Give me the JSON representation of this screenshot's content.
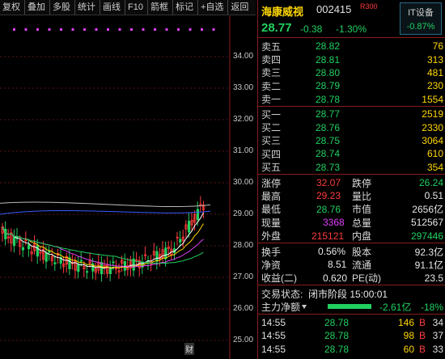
{
  "toolbar": {
    "items": [
      "复权",
      "叠加",
      "多股",
      "统计",
      "画线",
      "F10",
      "箭框",
      "标记",
      "+自选",
      "返回"
    ]
  },
  "chart": {
    "y_ticks": [
      "34.00",
      "33.00",
      "32.00",
      "31.00",
      "30.00",
      "29.00",
      "28.00",
      "27.00",
      "26.00",
      "25.00"
    ],
    "finance_marker": "财"
  },
  "stock": {
    "name": "海康威视",
    "code": "002415",
    "badge": "R300",
    "price": "28.77",
    "change": "-0.38",
    "change_pct": "-1.30%",
    "sector": {
      "name": "IT设备",
      "change": "-0.87%"
    }
  },
  "order_book": {
    "asks": [
      {
        "label": "卖五",
        "price": "28.82",
        "volume": "76"
      },
      {
        "label": "卖四",
        "price": "28.81",
        "volume": "313"
      },
      {
        "label": "卖三",
        "price": "28.80",
        "volume": "481"
      },
      {
        "label": "卖二",
        "price": "28.79",
        "volume": "230"
      },
      {
        "label": "卖一",
        "price": "28.78",
        "volume": "1554"
      }
    ],
    "bids": [
      {
        "label": "买一",
        "price": "28.77",
        "volume": "2519"
      },
      {
        "label": "买二",
        "price": "28.76",
        "volume": "2330"
      },
      {
        "label": "买三",
        "price": "28.75",
        "volume": "3064"
      },
      {
        "label": "买四",
        "price": "28.74",
        "volume": "610"
      },
      {
        "label": "买五",
        "price": "28.73",
        "volume": "354"
      }
    ]
  },
  "stats": {
    "limit_up_label": "涨停",
    "limit_up": "32.07",
    "limit_down_label": "跌停",
    "limit_down": "26.24",
    "high_label": "最高",
    "high": "29.23",
    "vol_ratio_label": "量比",
    "vol_ratio": "0.51",
    "low_label": "最低",
    "low": "28.76",
    "mktcap_label": "市值",
    "mktcap": "2656亿",
    "cur_vol_label": "现量",
    "cur_vol": "3368",
    "total_vol_label": "总量",
    "total_vol": "512567",
    "outer_label": "外盘",
    "outer": "215121",
    "inner_label": "内盘",
    "inner": "297446",
    "turnover_label": "换手",
    "turnover": "0.56%",
    "shares_label": "股本",
    "shares": "92.3亿",
    "nav_label": "净资",
    "nav": "8.51",
    "float_label": "流通",
    "float": "91.1亿",
    "eps_label": "收益(二)",
    "eps": "0.620",
    "pe_label": "PE(动)",
    "pe": "23.5"
  },
  "status": {
    "label": "交易状态:",
    "value": "闭市阶段 15:00:01",
    "flow_label": "主力净额",
    "flow_value": "-2.61亿",
    "flow_pct": "-18%"
  },
  "ticks": [
    {
      "time": "14:55",
      "price": "28.78",
      "volume": "146",
      "side": "B",
      "n": "34"
    },
    {
      "time": "14:55",
      "price": "28.78",
      "volume": "98",
      "side": "B",
      "n": "37"
    },
    {
      "time": "14:55",
      "price": "28.78",
      "volume": "60",
      "side": "B",
      "n": "33"
    }
  ],
  "colors": {
    "up": "#ff3b3b",
    "down": "#20d060",
    "highlight": "#e040fb",
    "accent": "#ffd700"
  }
}
